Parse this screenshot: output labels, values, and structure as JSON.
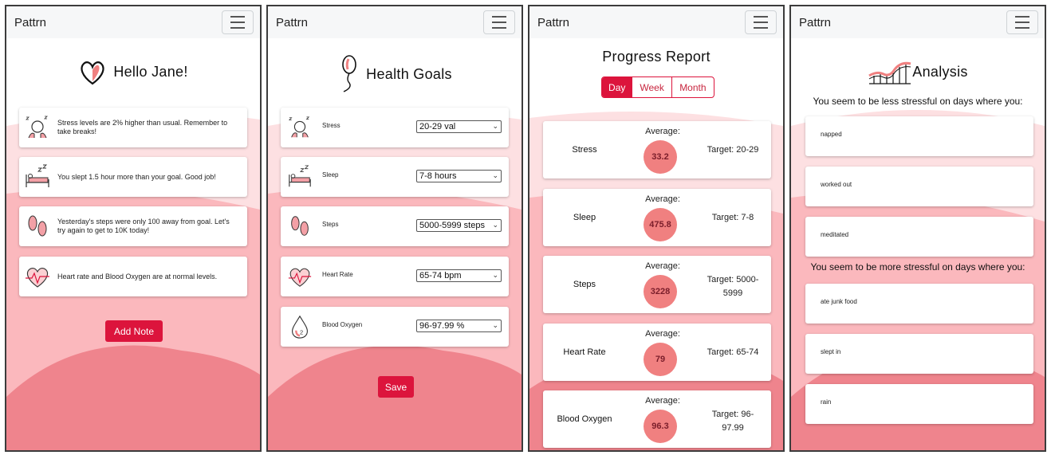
{
  "app": {
    "brand": "Pattrn"
  },
  "colors": {
    "accent": "#dc143c",
    "pink_light": "#fde0e2",
    "pink_mid": "#fbb8bd",
    "pink_dark": "#ef848d"
  },
  "home": {
    "greeting": "Hello Jane!",
    "notes": [
      {
        "icon": "stress-face-icon",
        "text": "Stress levels are 2% higher than usual. Remember to take breaks!"
      },
      {
        "icon": "sleep-bed-icon",
        "text": "You slept 1.5 hour more than your goal. Good job!"
      },
      {
        "icon": "footprints-icon",
        "text": "Yesterday's steps were only 100 away from goal. Let's try again to get to 10K today!"
      },
      {
        "icon": "heart-rate-icon",
        "text": "Heart rate and Blood Oxygen are at normal levels."
      }
    ],
    "add_note_label": "Add Note"
  },
  "goals": {
    "title": "Health Goals",
    "items": [
      {
        "icon": "stress-face-icon",
        "label": "Stress",
        "value": "20-29 val"
      },
      {
        "icon": "sleep-bed-icon",
        "label": "Sleep",
        "value": "7-8 hours"
      },
      {
        "icon": "footprints-icon",
        "label": "Steps",
        "value": "5000-5999 steps"
      },
      {
        "icon": "heart-rate-icon",
        "label": "Heart Rate",
        "value": "65-74 bpm"
      },
      {
        "icon": "blood-drop-icon",
        "label": "Blood Oxygen",
        "value": "96-97.99 %"
      }
    ],
    "save_label": "Save"
  },
  "progress": {
    "title": "Progress Report",
    "tabs": [
      {
        "label": "Day",
        "active": true
      },
      {
        "label": "Week",
        "active": false
      },
      {
        "label": "Month",
        "active": false
      }
    ],
    "average_label": "Average:",
    "items": [
      {
        "name": "Stress",
        "average": "33.2",
        "target_lines": [
          "Target: 20-29"
        ]
      },
      {
        "name": "Sleep",
        "average": "475.8",
        "target_lines": [
          "Target: 7-8"
        ]
      },
      {
        "name": "Steps",
        "average": "3228",
        "target_lines": [
          "Target: 5000-",
          "5999"
        ]
      },
      {
        "name": "Heart Rate",
        "average": "79",
        "target_lines": [
          "Target: 65-74"
        ]
      },
      {
        "name": "Blood Oxygen",
        "average": "96.3",
        "target_lines": [
          "Target: 96-",
          "97.99"
        ]
      }
    ]
  },
  "analysis": {
    "title": "Analysis",
    "less_heading": "You seem to be less stressful on days where you:",
    "less_items": [
      "napped",
      "worked out",
      "meditated"
    ],
    "more_heading": "You seem to be more stressful on days where you:",
    "more_items": [
      "ate junk food",
      "slept in",
      "rain"
    ]
  }
}
